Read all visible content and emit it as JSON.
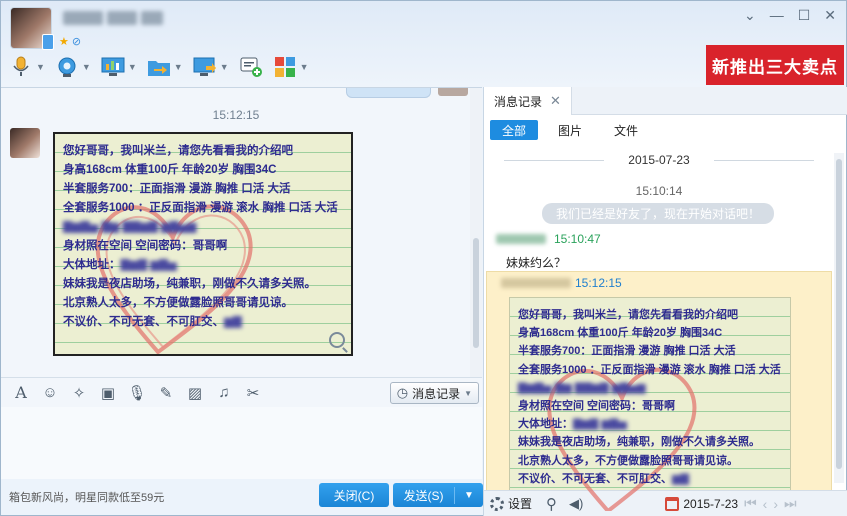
{
  "header": {
    "window_controls": [
      "⌄",
      "—",
      "☐",
      "✕"
    ],
    "promo_text": "新推出三大卖点"
  },
  "toolbar": {
    "items": [
      "microphone-icon",
      "video-icon",
      "screen-share-icon",
      "file-transfer-icon",
      "remote-desktop-icon",
      "add-chat-icon",
      "apps-icon"
    ]
  },
  "chat": {
    "time": "15:12:15"
  },
  "note": {
    "lines": [
      "您好哥哥，我叫米兰，请您先看看我的介绍吧",
      "身高168cm 体重100斤 年龄20岁 胸围34C",
      "半套服务700：正面指滑 漫游 胸推 口活 大活",
      "全套服务1000 ：正反面指滑 漫游 滚水 胸推 口活 大活",
      "身材照在空间 空间密码：哥哥啊",
      "大体地址：",
      "妹妹我是夜店助场，纯兼职，刚做不久请多关照。",
      "北京熟人太多，不方便做露脸照哥哥请见谅。",
      "不议价、不可无套、不可肛交、"
    ]
  },
  "input_tools": {
    "history_label": "消息记录"
  },
  "bottom": {
    "ad_text": "箱包新风尚，明星同款低至59元",
    "close_label": "关闭(C)",
    "send_label": "发送(S)"
  },
  "history": {
    "tab_label": "消息记录",
    "filters": [
      "全部",
      "图片",
      "文件"
    ],
    "date": "2015-07-23",
    "time1": "15:10:14",
    "system_msg": "我们已经是好友了，现在开始对话吧！",
    "msg1_time": "15:10:47",
    "msg1_text": "妹妹约么？",
    "msg2_time": "15:12:15",
    "footer": {
      "settings_label": "设置",
      "date_label": "2015-7-23"
    }
  },
  "colors": {
    "accent": "#1e8ce0",
    "promo": "#d9232b",
    "highlight": "#fdf0c9",
    "note_text": "#2e2c8f"
  }
}
